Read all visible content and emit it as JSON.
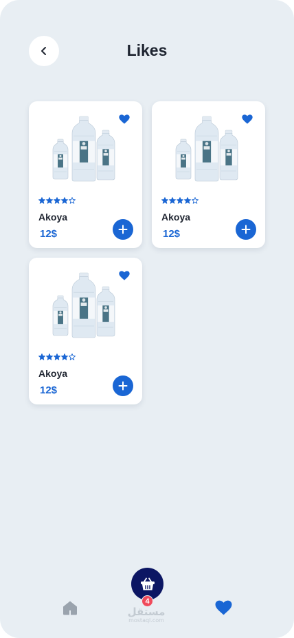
{
  "header": {
    "title": "Likes"
  },
  "products": [
    {
      "name": "Akoya",
      "price": "12$",
      "rating": 4,
      "max_rating": 5,
      "liked": true
    },
    {
      "name": "Akoya",
      "price": "12$",
      "rating": 4,
      "max_rating": 5,
      "liked": true
    },
    {
      "name": "Akoya",
      "price": "12$",
      "rating": 4,
      "max_rating": 5,
      "liked": true
    }
  ],
  "bottom_nav": {
    "cart_count": "4",
    "active_tab": "likes"
  },
  "watermark": {
    "arabic": "مستقل",
    "latin": "mostaql.com"
  },
  "colors": {
    "accent": "#1a66d4",
    "cart_bg": "#0c1663",
    "badge": "#f04a5b",
    "background": "#e8eef3",
    "inactive_icon": "#9aa3ad"
  },
  "icons": {
    "back": "chevron-left-icon",
    "favorite": "heart-icon",
    "add": "plus-icon",
    "home": "home-icon",
    "cart": "basket-icon",
    "likes": "heart-icon"
  }
}
